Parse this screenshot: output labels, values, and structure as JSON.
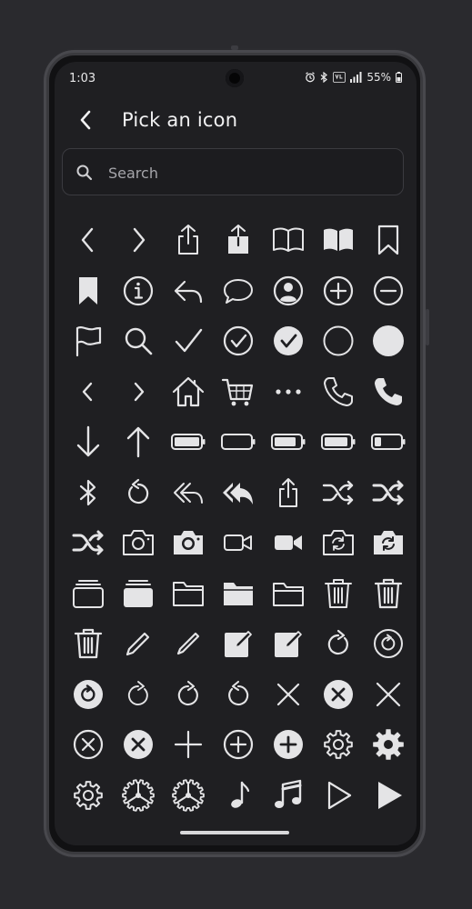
{
  "status_bar": {
    "time": "1:03",
    "battery": "55%",
    "network": "VoLTE"
  },
  "header": {
    "title": "Pick an icon",
    "back_icon": "chevron-left-icon"
  },
  "search": {
    "placeholder": "Search",
    "value": "",
    "icon": "search-icon"
  },
  "icon_rows": [
    [
      "chevron-left",
      "chevron-right",
      "share-outline",
      "share-filled",
      "book-outline",
      "book-filled",
      "bookmark-outline"
    ],
    [
      "bookmark-filled",
      "info-circle",
      "reply",
      "chat-bubble",
      "person-circle",
      "plus-circle",
      "minus-circle"
    ],
    [
      "flag",
      "magnifier",
      "checkmark",
      "check-circle",
      "check-circle-filled",
      "circle-outline",
      "circle-filled"
    ],
    [
      "chevron-left-small",
      "chevron-right-small",
      "house",
      "cart",
      "ellipsis",
      "phone-outline",
      "phone-filled"
    ],
    [
      "arrow-down",
      "arrow-up",
      "battery-full",
      "battery-empty",
      "battery-75",
      "battery-50",
      "battery-25"
    ],
    [
      "bluetooth",
      "rotate-left",
      "reply-all",
      "reply-all-filled",
      "share-small",
      "shuffle",
      "shuffle-bold"
    ],
    [
      "shuffle-alt",
      "camera-outline",
      "camera-filled",
      "video-outline",
      "video-filled",
      "camera-rotate",
      "camera-rotate-filled"
    ],
    [
      "stack-outline",
      "stack-filled",
      "folder-outline",
      "folder-filled",
      "folder-small",
      "trash-outline",
      "trash-medium"
    ],
    [
      "trash-bold",
      "pencil",
      "pencil-thin",
      "edit-square",
      "edit-square-light",
      "rotate-right",
      "rotate-right-circle"
    ],
    [
      "rotate-right-circle-filled",
      "rotate-right-thin",
      "rotate-right-alt",
      "rotate-left-alt",
      "xmark",
      "xmark-circle-filled",
      "xmark-large"
    ],
    [
      "xmark-circle",
      "xmark-circle-filled-2",
      "plus",
      "plus-circle-outline",
      "plus-circle-filled",
      "gear-outline",
      "gear-filled"
    ],
    [
      "gear-thin",
      "gear-wheel",
      "gear-wheel-alt",
      "music-note",
      "music-notes",
      "play-outline",
      "play-filled"
    ]
  ]
}
